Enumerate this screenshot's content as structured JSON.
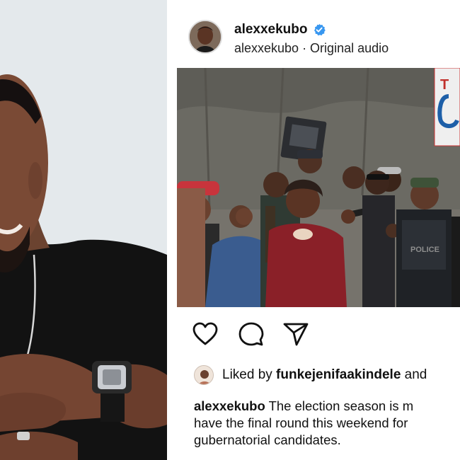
{
  "post": {
    "username": "alexxekubo",
    "subtitle": "alexxekubo · Original audio",
    "liked_by_prefix": "Liked by ",
    "liked_by_user": "funkejenifaakindele",
    "liked_by_suffix": " and",
    "caption_user": "alexxekubo",
    "caption_line1": " The election season is m",
    "caption_line2": "have the final round this weekend for",
    "caption_line3": "gubernatorial candidates."
  },
  "icons": {
    "verified": "verified-badge-icon",
    "like": "heart-icon",
    "comment": "comment-bubble-icon",
    "share": "paper-plane-icon"
  },
  "colors": {
    "verified_blue": "#3897f0",
    "text": "#111111"
  }
}
